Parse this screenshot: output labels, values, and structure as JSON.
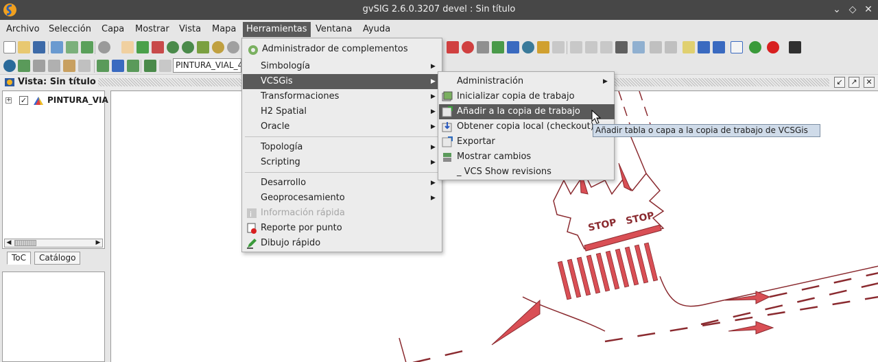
{
  "window": {
    "title": "gvSIG 2.6.0.3207 devel : Sin título"
  },
  "menubar": [
    "Archivo",
    "Selección",
    "Capa",
    "Mostrar",
    "Vista",
    "Mapa",
    "Herramientas",
    "Ventana",
    "Ayuda"
  ],
  "toolbar": {
    "layer_combo_value": "PINTURA_VIAL_4"
  },
  "view": {
    "title": "Vista: Sin título"
  },
  "toc": {
    "layer_name": "PINTURA_VIA",
    "checked_glyph": "✓",
    "expander_glyph": "+",
    "tabs": [
      "ToC",
      "Catálogo"
    ]
  },
  "herramientas_menu": {
    "items": [
      {
        "label": "Administrador de complementos"
      },
      {
        "label": "Simbología"
      },
      {
        "label": "VCSGis"
      },
      {
        "label": "Transformaciones"
      },
      {
        "label": "H2 Spatial"
      },
      {
        "label": "Oracle"
      },
      {
        "label": "Topología"
      },
      {
        "label": "Scripting"
      },
      {
        "label": "Desarrollo"
      },
      {
        "label": "Geoprocesamiento"
      },
      {
        "label": "Información rápida"
      },
      {
        "label": "Reporte por punto"
      },
      {
        "label": "Dibujo rápido"
      }
    ]
  },
  "vcsgis_menu": {
    "items": [
      {
        "label": "Administración"
      },
      {
        "label": "Inicializar copia de trabajo"
      },
      {
        "label": "Añadir a la copia de trabajo"
      },
      {
        "label": "Obtener copia local (checkout)"
      },
      {
        "label": "Exportar"
      },
      {
        "label": "Mostrar cambios"
      },
      {
        "label": "_ VCS Show revisions"
      }
    ]
  },
  "tooltip": "Añadir tabla o capa a la copia de trabajo de VCSGis",
  "map": {
    "marking_text": "STOP"
  },
  "colors": {
    "accent_highlight": "#5a5a5a",
    "road_marking": "#d94f55",
    "titlebar": "#474747"
  }
}
